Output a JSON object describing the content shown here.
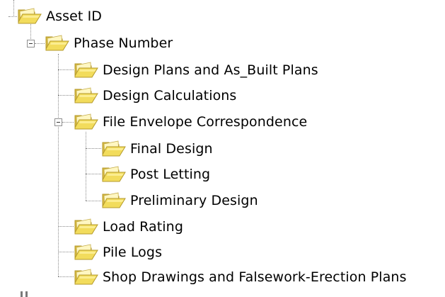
{
  "tree": {
    "nodes": [
      {
        "id": "asset-id",
        "label": "Asset ID",
        "level": 0,
        "expanded": true
      },
      {
        "id": "phase-number",
        "label": "Phase Number",
        "level": 1,
        "expanded": true
      },
      {
        "id": "design-plans",
        "label": "Design Plans and As_Built Plans",
        "level": 2
      },
      {
        "id": "design-calculations",
        "label": "Design Calculations",
        "level": 2
      },
      {
        "id": "file-envelope",
        "label": "File Envelope Correspondence",
        "level": 2,
        "expanded": true
      },
      {
        "id": "final-design",
        "label": "Final Design",
        "level": 3
      },
      {
        "id": "post-letting",
        "label": "Post Letting",
        "level": 3
      },
      {
        "id": "preliminary-design",
        "label": "Preliminary Design",
        "level": 3
      },
      {
        "id": "load-rating",
        "label": "Load Rating",
        "level": 2
      },
      {
        "id": "pile-logs",
        "label": "Pile Logs",
        "level": 2
      },
      {
        "id": "shop-drawings",
        "label": "Shop Drawings and Falsework-Erection Plans",
        "level": 2
      }
    ],
    "icon": "folder-open-icon",
    "colors": {
      "folder_fill": "#f2dc5c",
      "folder_light": "#fff3a6",
      "folder_edge": "#b49a2b",
      "connector": "#8a8a8a"
    }
  }
}
